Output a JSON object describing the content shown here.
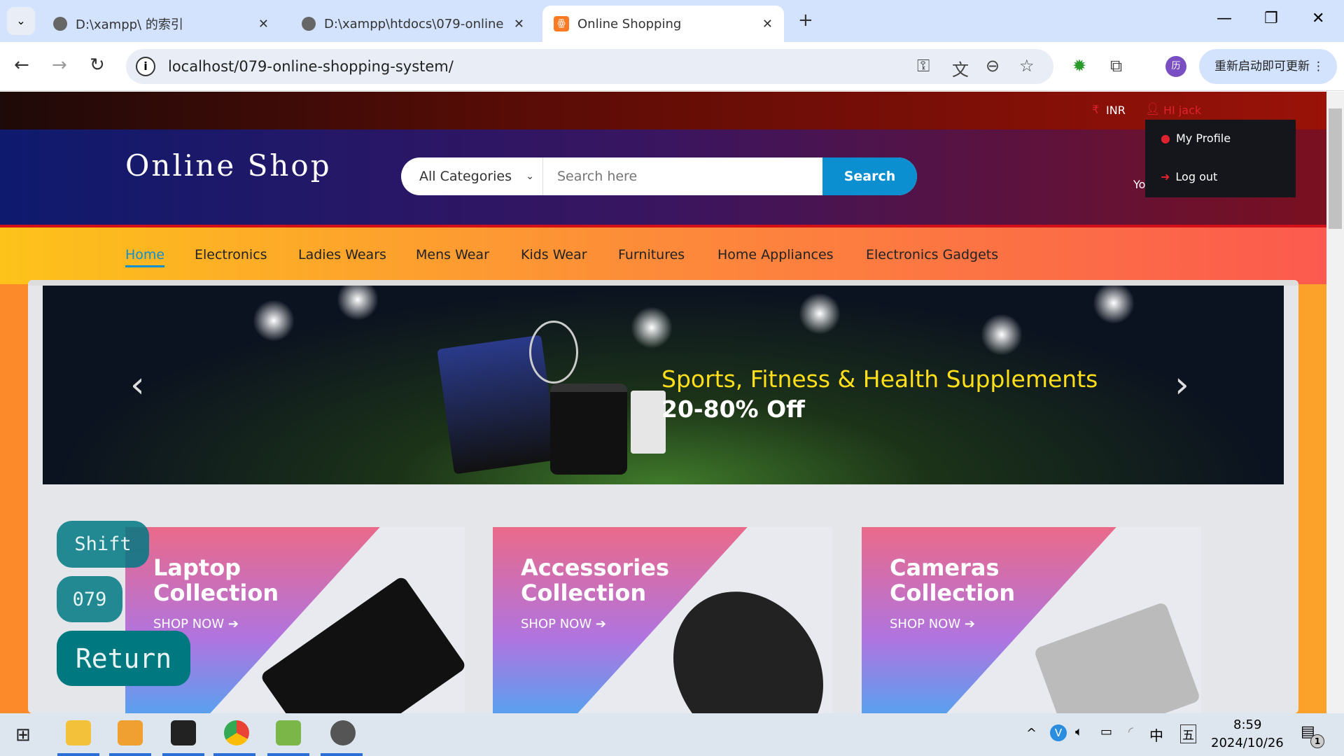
{
  "browser": {
    "tabs": [
      {
        "title": "D:\\xampp\\ 的索引"
      },
      {
        "title": "D:\\xampp\\htdocs\\079-online"
      },
      {
        "title": "Online Shopping"
      }
    ],
    "url": "localhost/079-online-shopping-system/",
    "update_label": "重新启动即可更新",
    "profile_initial": "历"
  },
  "topbar": {
    "currency": "INR",
    "currency_icon": "₹",
    "user": "HI jack"
  },
  "dropdown": {
    "items": [
      {
        "label": "My Profile",
        "icon": "user-circle-icon"
      },
      {
        "label": "Log out",
        "icon": "sign-out-icon"
      }
    ]
  },
  "header": {
    "logo": "Online Shop",
    "category": "All Categories",
    "search_placeholder": "Search here",
    "search_button": "Search",
    "partial_text": "Yo"
  },
  "nav": {
    "items": [
      "Home",
      "Electronics",
      "Ladies Wears",
      "Mens Wear",
      "Kids Wear",
      "Furnitures",
      "Home Appliances",
      "Electronics Gadgets"
    ],
    "active": "Home"
  },
  "banner": {
    "title": "Sports, Fitness & Health Supplements",
    "subtitle": "20-80% Off"
  },
  "collections": [
    {
      "line1": "Laptop",
      "line2": "Collection",
      "cta": "SHOP NOW"
    },
    {
      "line1": "Accessories",
      "line2": "Collection",
      "cta": "SHOP NOW"
    },
    {
      "line1": "Cameras",
      "line2": "Collection",
      "cta": "SHOP NOW"
    }
  ],
  "overlay": {
    "shift": "Shift",
    "code": "079",
    "return": "Return"
  },
  "taskbar": {
    "time": "8:59",
    "date": "2024/10/26",
    "ime": "中",
    "ime2": "五",
    "notifications": "1"
  },
  "colors": {
    "accent": "#0b8fd1",
    "red": "#e0222e",
    "banner_title": "#ffde1a"
  }
}
